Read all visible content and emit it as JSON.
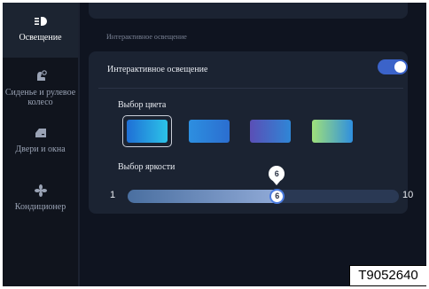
{
  "sidebar": {
    "items": [
      {
        "label": "Освещение",
        "icon": "light-icon",
        "active": true
      },
      {
        "label": "Сиденье и рулевое колесо",
        "icon": "seat-steering-icon",
        "active": false
      },
      {
        "label": "Двери и окна",
        "icon": "door-window-icon",
        "active": false
      },
      {
        "label": "Кондиционер",
        "icon": "fan-icon",
        "active": false
      }
    ]
  },
  "main": {
    "section_title": "Интерактивное освещение",
    "toggle_row": {
      "label": "Интерактивное освещение",
      "enabled": true
    },
    "color_select": {
      "label": "Выбор цвета",
      "selected_index": 0,
      "swatches": [
        {
          "name": "blue-cyan",
          "from": "#1f6fd6",
          "to": "#2cc3e8"
        },
        {
          "name": "blue",
          "from": "#2d8fe0",
          "to": "#2b6ed0"
        },
        {
          "name": "indigo",
          "from": "#5a4fb6",
          "to": "#2f86d6"
        },
        {
          "name": "green-blue",
          "from": "#9fe07a",
          "to": "#2f8fdf"
        }
      ]
    },
    "brightness": {
      "label": "Выбор яркости",
      "min": "1",
      "max": "10",
      "value": "6",
      "bubble_value": "6",
      "fraction": 0.55
    }
  },
  "stamp_id": "T9052640"
}
